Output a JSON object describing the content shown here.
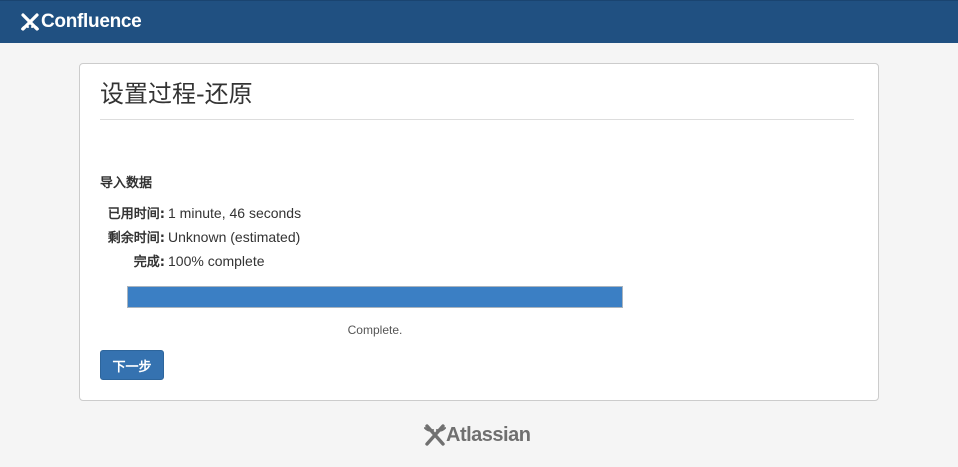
{
  "header": {
    "brand_name": "Confluence",
    "logo_icon": "confluence-x-icon",
    "background_color": "#205081"
  },
  "panel": {
    "title": "设置过程-还原",
    "section_heading": "导入数据",
    "stats": [
      {
        "label": "已用时间:",
        "value": "1 minute, 46 seconds"
      },
      {
        "label": "剩余时间:",
        "value": "Unknown (estimated)"
      },
      {
        "label": "完成:",
        "value": "100% complete"
      }
    ],
    "progress": {
      "fraction": 1.0,
      "status_text": "Complete.",
      "fill_color": "#3b7fc4"
    },
    "next_button_label": "下一步"
  },
  "footer": {
    "logo_name": "Atlassian",
    "logo_icon": "atlassian-x-icon"
  }
}
